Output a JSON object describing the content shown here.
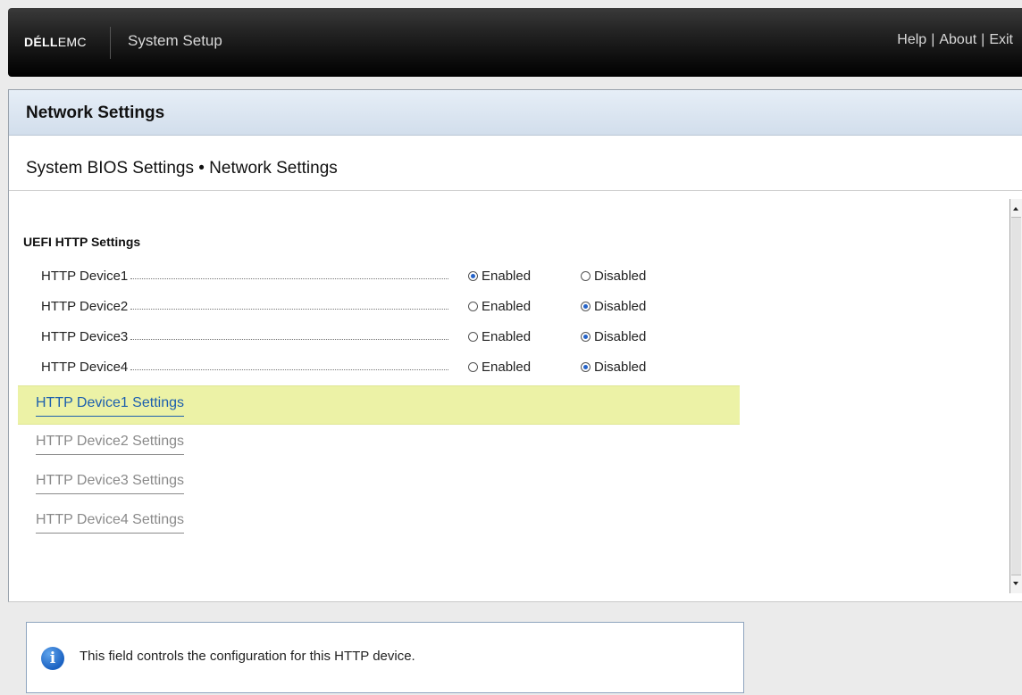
{
  "header": {
    "logo_dell": "DÉLL",
    "logo_emc": "EMC",
    "app_title": "System Setup",
    "links": [
      "Help",
      "About",
      "Exit"
    ],
    "separator": "|"
  },
  "page": {
    "title": "Network Settings",
    "breadcrumb": "System BIOS Settings • Network Settings"
  },
  "section": {
    "title": "UEFI HTTP Settings",
    "devices": [
      {
        "label": "HTTP Device1",
        "enabled": true
      },
      {
        "label": "HTTP Device2",
        "enabled": false
      },
      {
        "label": "HTTP Device3",
        "enabled": false
      },
      {
        "label": "HTTP Device4",
        "enabled": false
      }
    ],
    "option_enabled": "Enabled",
    "option_disabled": "Disabled",
    "links": [
      {
        "label": "HTTP Device1 Settings",
        "selected": true
      },
      {
        "label": "HTTP Device2 Settings",
        "selected": false
      },
      {
        "label": "HTTP Device3 Settings",
        "selected": false
      },
      {
        "label": "HTTP Device4 Settings",
        "selected": false
      }
    ]
  },
  "help": {
    "icon": "info-icon",
    "text": "This field controls the configuration for this HTTP device."
  },
  "colors": {
    "selected_row": "#ecf2a6",
    "link_selected": "#1c5fae",
    "radio_on": "#2563c8"
  }
}
